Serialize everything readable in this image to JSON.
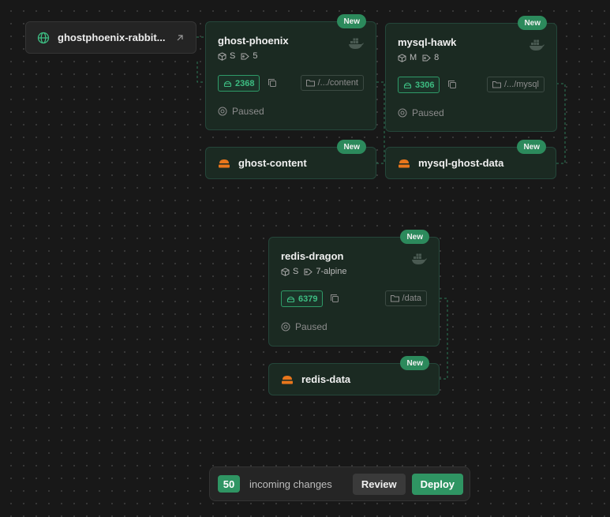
{
  "domain": {
    "label": "ghostphoenix-rabbit..."
  },
  "services": [
    {
      "name": "ghost-phoenix",
      "badge": "New",
      "size": "S",
      "tag": "5",
      "port": "2368",
      "volume_path": "/.../content",
      "status": "Paused"
    },
    {
      "name": "mysql-hawk",
      "badge": "New",
      "size": "M",
      "tag": "8",
      "port": "3306",
      "volume_path": "/.../mysql",
      "status": "Paused"
    },
    {
      "name": "redis-dragon",
      "badge": "New",
      "size": "S",
      "tag": "7-alpine",
      "port": "6379",
      "volume_path": "/data",
      "status": "Paused"
    }
  ],
  "volumes": [
    {
      "name": "ghost-content",
      "badge": "New"
    },
    {
      "name": "mysql-ghost-data",
      "badge": "New"
    },
    {
      "name": "redis-data",
      "badge": "New"
    }
  ],
  "changes_bar": {
    "count": "50",
    "label": "incoming changes",
    "review": "Review",
    "deploy": "Deploy"
  },
  "colors": {
    "background": "#181818",
    "accent": "#2f9563",
    "card": "#1b2a22",
    "volume_icon": "#e8761c"
  },
  "icons": [
    "globe-icon",
    "arrow-up-right-icon",
    "docker-icon",
    "cube-icon",
    "tag-icon",
    "port-icon",
    "copy-icon",
    "folder-icon",
    "status-icon",
    "volume-icon"
  ]
}
